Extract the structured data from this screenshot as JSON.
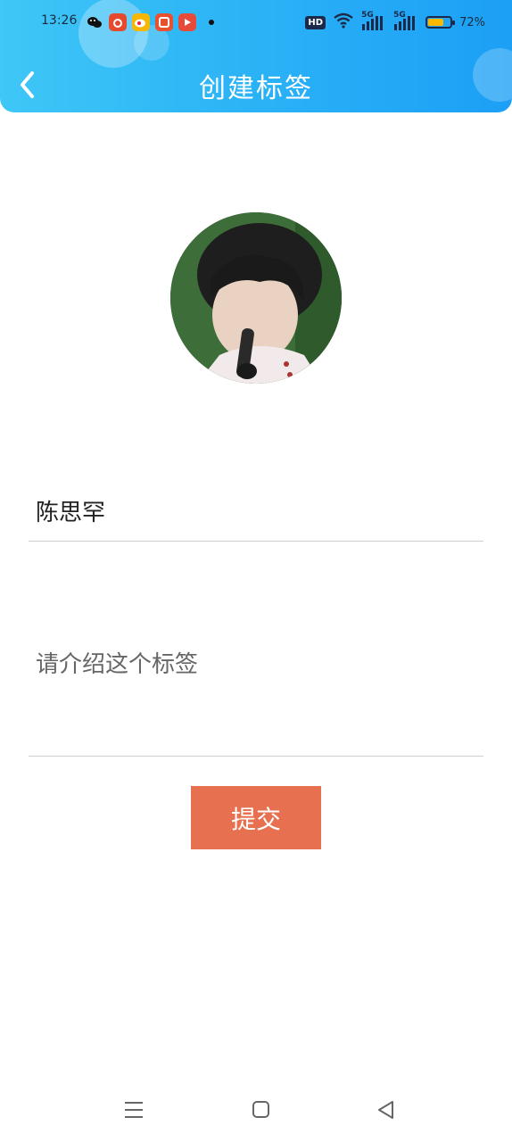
{
  "status_bar": {
    "time": "13:26",
    "apps": [
      {
        "icon": "wechat-icon",
        "color": "#ffffff"
      },
      {
        "icon": "app-red-icon",
        "color": "#e64a2e"
      },
      {
        "icon": "weibo-icon",
        "color": "#f7b600"
      },
      {
        "icon": "taobao-icon",
        "color": "#e8502f"
      },
      {
        "icon": "video-play-icon",
        "color": "#e84a3a"
      }
    ],
    "hd_label": "HD",
    "signal_1": "5G",
    "signal_2": "5G",
    "battery_percent": "72%",
    "battery_level": 0.72
  },
  "header": {
    "title": "创建标签",
    "accent": "#2cb4f6"
  },
  "form": {
    "name_value": "陈思罕",
    "description_placeholder": "请介绍这个标签",
    "submit_label": "提交",
    "submit_color": "#e6704f"
  }
}
